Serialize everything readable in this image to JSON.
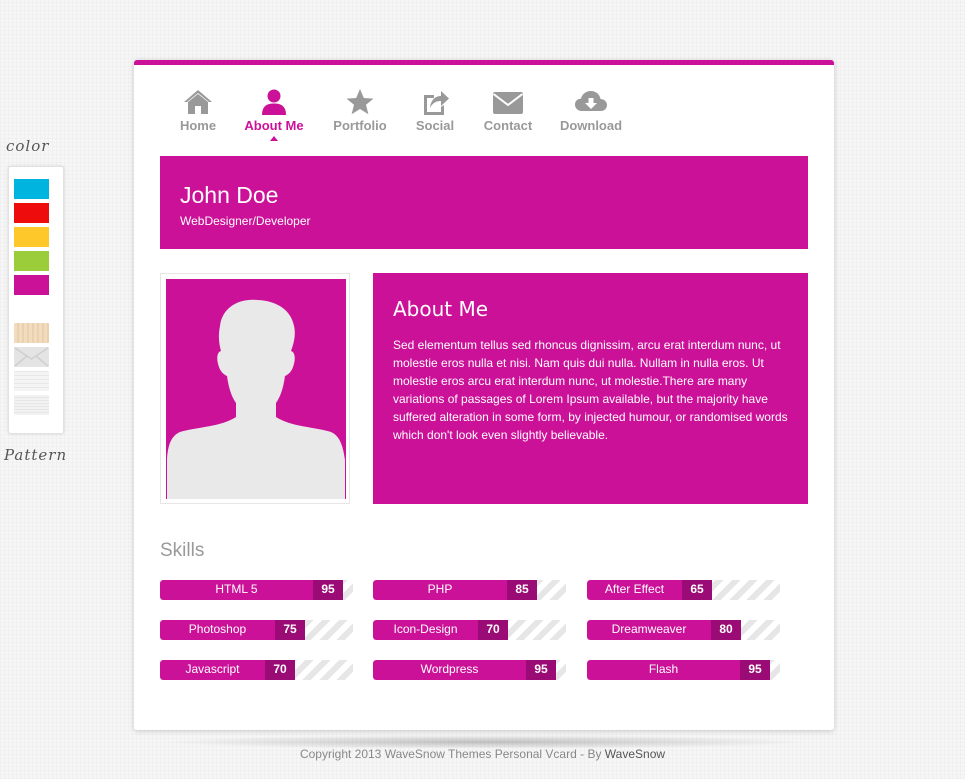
{
  "theme": {
    "accent": "#cc1199",
    "accent_dark": "#9b0b76",
    "nav_inactive": "#999999"
  },
  "switcher": {
    "color_label": "color",
    "pattern_label": "Pattern",
    "colors": [
      "#00b4e0",
      "#ee0c0c",
      "#ffc82a",
      "#9bcc3a",
      "#cc1199"
    ],
    "patterns": [
      "wood",
      "envelope",
      "waves",
      "grid"
    ]
  },
  "nav": {
    "items": [
      {
        "label": "Home",
        "icon": "home-icon"
      },
      {
        "label": "About Me",
        "icon": "user-icon",
        "active": true
      },
      {
        "label": "Portfolio",
        "icon": "star-icon"
      },
      {
        "label": "Social",
        "icon": "share-icon"
      },
      {
        "label": "Contact",
        "icon": "envelope-icon"
      },
      {
        "label": "Download",
        "icon": "cloud-download-icon"
      }
    ]
  },
  "header": {
    "name": "John Doe",
    "title": "WebDesigner/Developer"
  },
  "about": {
    "heading": "About Me",
    "text": "Sed elementum tellus sed rhoncus dignissim, arcu erat interdum nunc, ut molestie eros nulla et nisi. Nam quis dui nulla. Nullam in nulla eros. Ut molestie eros arcu erat interdum nunc, ut molestie.There are many variations of passages of Lorem Ipsum available, but the majority have suffered alteration in some form, by injected humour, or randomised words which don't look even slightly believable."
  },
  "skills": {
    "title": "Skills",
    "items": [
      {
        "name": "HTML 5",
        "value": "95",
        "percent": 95
      },
      {
        "name": "PHP",
        "value": "85",
        "percent": 85
      },
      {
        "name": "After Effect",
        "value": "65",
        "percent": 65
      },
      {
        "name": "Photoshop",
        "value": "75",
        "percent": 75
      },
      {
        "name": "Icon-Design",
        "value": "70",
        "percent": 70
      },
      {
        "name": "Dreamweaver",
        "value": "80",
        "percent": 80
      },
      {
        "name": "Javascript",
        "value": "70",
        "percent": 70
      },
      {
        "name": "Wordpress",
        "value": "95",
        "percent": 95
      },
      {
        "name": "Flash",
        "value": "95",
        "percent": 95
      }
    ]
  },
  "footer": {
    "text": "Copyright 2013 WaveSnow Themes Personal Vcard - By ",
    "link": "WaveSnow"
  }
}
